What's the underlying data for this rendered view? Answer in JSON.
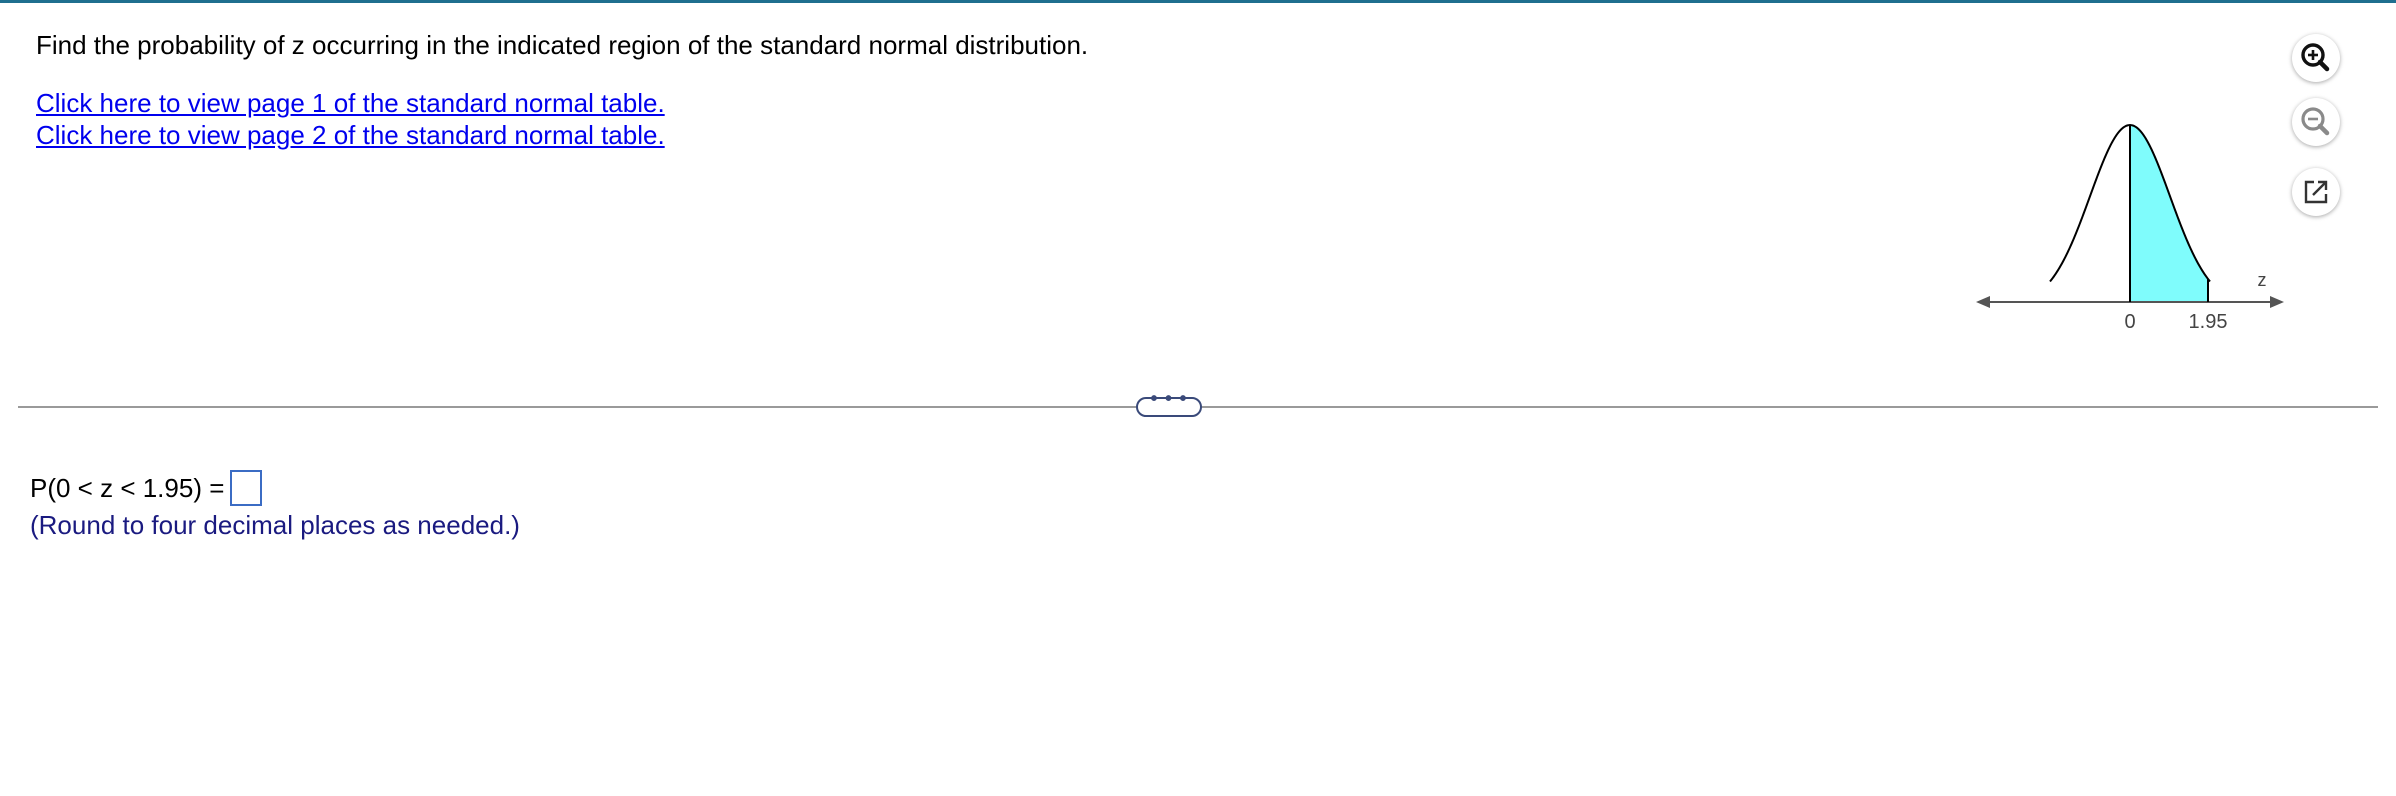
{
  "question": {
    "text": "Find the probability of z occurring in the indicated region of the standard normal distribution."
  },
  "links": {
    "table_page_1": "Click here to view page 1 of the standard normal table.",
    "table_page_2": "Click here to view page 2 of the standard normal table."
  },
  "graph": {
    "axis_variable": "z",
    "tick_left": "0",
    "tick_right": "1.95",
    "shaded_from": 0,
    "shaded_to": 1.95,
    "shade_color": "#7ffcfc"
  },
  "tools": {
    "zoom_in_icon": "zoom-in-icon",
    "zoom_out_icon": "zoom-out-icon",
    "popout_icon": "popout-icon"
  },
  "divider": {
    "handle_label": "• • •"
  },
  "answer": {
    "expression": "P(0 < z < 1.95) =",
    "value": "",
    "hint": "(Round to four decimal places as needed.)"
  }
}
